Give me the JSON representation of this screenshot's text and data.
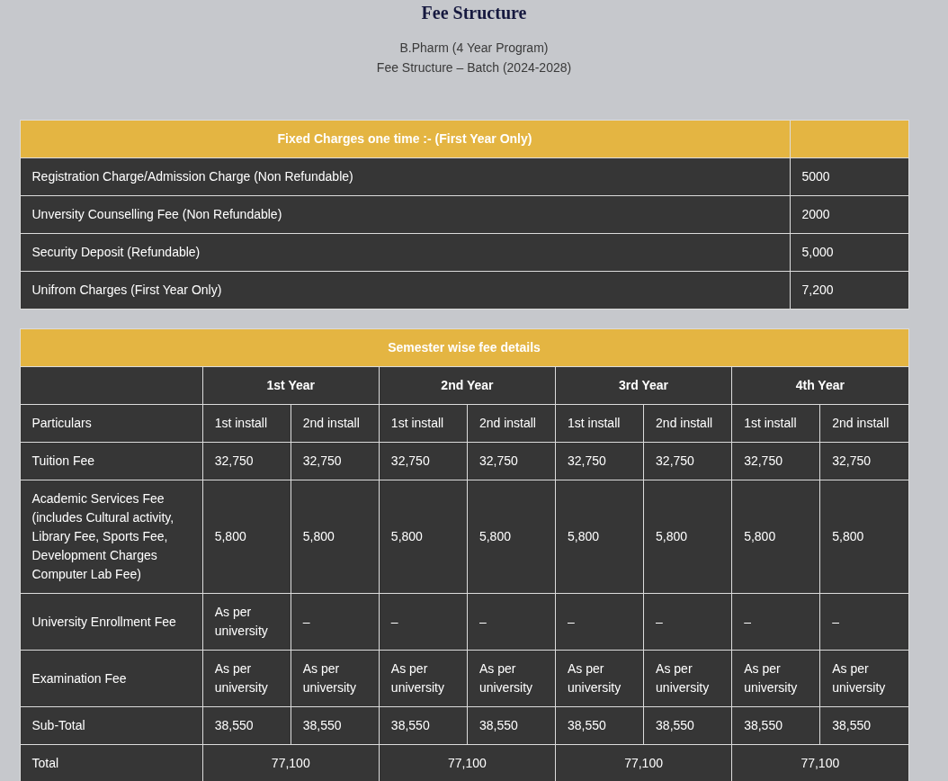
{
  "title": "Fee Structure",
  "subtitle_lines": [
    "B.Pharm (4 Year Program)",
    "Fee Structure – Batch (2024-2028)"
  ],
  "fixed_charges": {
    "heading": "Fixed Charges one time :- (First Year Only)",
    "rows": [
      {
        "label": "Registration Charge/Admission Charge (Non Refundable)",
        "amount": "5000"
      },
      {
        "label": "Unversity Counselling Fee (Non Refundable)",
        "amount": "2000"
      },
      {
        "label": "Security Deposit (Refundable)",
        "amount": "5,000"
      },
      {
        "label": "Unifrom Charges (First Year Only)",
        "amount": "7,200"
      }
    ]
  },
  "semester_fees": {
    "heading": "Semester wise fee details",
    "years": [
      "1st Year",
      "2nd Year",
      "3rd Year",
      "4th Year"
    ],
    "rows": [
      {
        "kind": "installments",
        "label": "Particulars",
        "cells": [
          "1st install",
          "2nd install",
          "1st install",
          "2nd install",
          "1st install",
          "2nd install",
          "1st install",
          "2nd install"
        ]
      },
      {
        "kind": "installments",
        "label": "Tuition Fee",
        "cells": [
          "32,750",
          "32,750",
          "32,750",
          "32,750",
          "32,750",
          "32,750",
          "32,750",
          "32,750"
        ]
      },
      {
        "kind": "installments",
        "label": "Academic Services Fee (includes Cultural activity, Library Fee, Sports Fee, Development Charges Computer Lab Fee)",
        "cells": [
          "5,800",
          "5,800",
          "5,800",
          "5,800",
          "5,800",
          "5,800",
          "5,800",
          "5,800"
        ]
      },
      {
        "kind": "installments",
        "label": "University Enrollment Fee",
        "cells": [
          "As per university",
          "–",
          "–",
          "–",
          "–",
          "–",
          "–",
          "–"
        ]
      },
      {
        "kind": "installments",
        "label": "Examination Fee",
        "cells": [
          "As per university",
          "As per university",
          "As per university",
          "As per university",
          "As per university",
          "As per university",
          "As per university",
          "As per university"
        ]
      },
      {
        "kind": "installments",
        "label": "Sub-Total",
        "cells": [
          "38,550",
          "38,550",
          "38,550",
          "38,550",
          "38,550",
          "38,550",
          "38,550",
          "38,550"
        ]
      },
      {
        "kind": "yearly",
        "label": "Total",
        "cells": [
          {
            "text": "77,100",
            "colspan": 2
          },
          {
            "text": "77,100",
            "colspan": 2
          },
          {
            "text": "77,100",
            "colspan": 2
          },
          {
            "text": "77,100",
            "colspan": 2
          }
        ]
      }
    ]
  }
}
